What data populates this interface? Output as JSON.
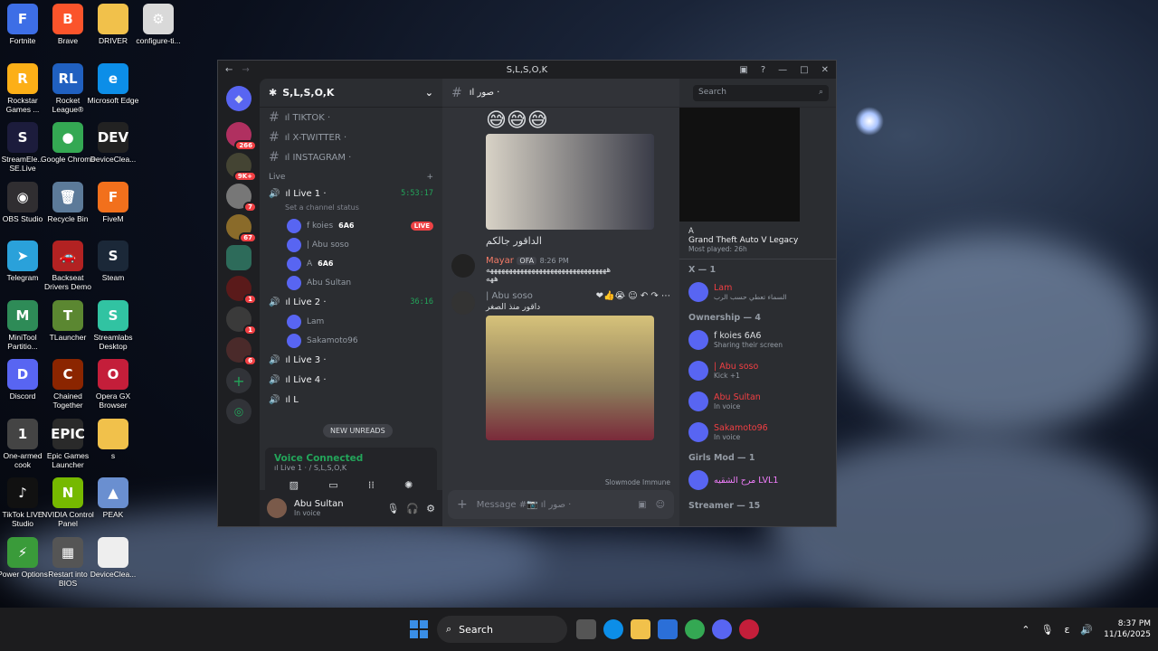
{
  "desktop": {
    "icons": [
      {
        "label": "Fortnite",
        "glyph": "F",
        "color": "#3d6ee6"
      },
      {
        "label": "Brave",
        "glyph": "B",
        "color": "#fb542b"
      },
      {
        "label": "DRIVER",
        "glyph": "",
        "color": "#f1c14b"
      },
      {
        "label": "configure-ti...",
        "glyph": "⚙",
        "color": "#d9d9d9"
      },
      {
        "label": "Rockstar Games ...",
        "glyph": "R",
        "color": "#fcaf17"
      },
      {
        "label": "Rocket League®",
        "glyph": "RL",
        "color": "#2060c0"
      },
      {
        "label": "Microsoft Edge",
        "glyph": "e",
        "color": "#0c8ee8"
      },
      {
        "label": "StreamEle... SE.Live",
        "glyph": "S",
        "color": "#1c1c3c"
      },
      {
        "label": "Google Chrome",
        "glyph": "●",
        "color": "#34a853"
      },
      {
        "label": "DeviceClea...",
        "glyph": "DEV",
        "color": "#222222"
      },
      {
        "label": "OBS Studio",
        "glyph": "◉",
        "color": "#302e31"
      },
      {
        "label": "Recycle Bin",
        "glyph": "🗑",
        "color": "#5c7a99"
      },
      {
        "label": "FiveM",
        "glyph": "F",
        "color": "#f2701c"
      },
      {
        "label": "Telegram",
        "glyph": "➤",
        "color": "#2aa1da"
      },
      {
        "label": "Backseat Drivers Demo",
        "glyph": "🚗",
        "color": "#b22222"
      },
      {
        "label": "Steam",
        "glyph": "S",
        "color": "#1b2838"
      },
      {
        "label": "MiniTool Partitio...",
        "glyph": "M",
        "color": "#2e8b57"
      },
      {
        "label": "TLauncher",
        "glyph": "T",
        "color": "#5b8731"
      },
      {
        "label": "Streamlabs Desktop",
        "glyph": "S",
        "color": "#31c3a2"
      },
      {
        "label": "Discord",
        "glyph": "D",
        "color": "#5865f2"
      },
      {
        "label": "Chained Together",
        "glyph": "C",
        "color": "#8b2500"
      },
      {
        "label": "Opera GX Browser",
        "glyph": "O",
        "color": "#c41e3a"
      },
      {
        "label": "One-armed cook",
        "glyph": "1",
        "color": "#444444"
      },
      {
        "label": "Epic Games Launcher",
        "glyph": "EPIC",
        "color": "#2a2a2a"
      },
      {
        "label": "s",
        "glyph": "",
        "color": "#f1c14b"
      },
      {
        "label": "TikTok LIVE Studio",
        "glyph": "♪",
        "color": "#111111"
      },
      {
        "label": "NVIDIA Control Panel",
        "glyph": "N",
        "color": "#76b900"
      },
      {
        "label": "PEAK",
        "glyph": "▲",
        "color": "#6a8fd0"
      },
      {
        "label": "Power Options",
        "glyph": "⚡",
        "color": "#3a9b3a"
      },
      {
        "label": "Restart into BIOS",
        "glyph": "▦",
        "color": "#555555"
      },
      {
        "label": "DeviceClea...",
        "glyph": "",
        "color": "#eeeeee"
      }
    ]
  },
  "window": {
    "title": "S,L,S,O,K",
    "server_name": "S,L,S,O,K",
    "text_channels": [
      "ıl TIKTOK ·",
      "ıl X-TWITTER ·",
      "ıl INSTAGRAM ·"
    ],
    "voice_category": "Live",
    "voice_channels": [
      {
        "name": "ıl Live 1 ·",
        "time": "5:53:17",
        "status": "Set a channel status",
        "members": [
          {
            "name": "f koies",
            "tag": "6A6",
            "live": "LIVE"
          },
          {
            "name": "| Abu soso",
            "tag": "",
            "live": ""
          },
          {
            "name": "A",
            "tag": "6A6",
            "live": ""
          },
          {
            "name": "Abu Sultan",
            "tag": "",
            "live": ""
          }
        ]
      },
      {
        "name": "ıl Live 2 ·",
        "time": "36:16",
        "status": "",
        "members": [
          {
            "name": "Lam",
            "tag": "",
            "live": ""
          },
          {
            "name": "Sakamoto96",
            "tag": "",
            "live": ""
          }
        ]
      },
      {
        "name": "ıl Live 3 ·",
        "time": "",
        "status": "",
        "members": []
      },
      {
        "name": "ıl Live 4 ·",
        "time": "",
        "status": "",
        "members": []
      },
      {
        "name": "ıl L",
        "time": "",
        "status": "",
        "members": []
      }
    ],
    "new_unreads": "NEW UNREADS",
    "voice_connected": "Voice Connected",
    "voice_location": "ıl Live 1 · / S,L,S,O,K",
    "user": {
      "name": "Abu Sultan",
      "status": "In voice"
    },
    "guild_badges": [
      "266",
      "9K+",
      "7",
      "67",
      "1",
      "1",
      "1",
      "6"
    ],
    "chat": {
      "channel": "ıl صور ·",
      "search_placeholder": "Search",
      "caption1": "الداقور جالكم",
      "msg2_author": "Mayar",
      "msg2_badge": "OFA",
      "msg2_time": "8:26 PM",
      "msg2_text": "ههههههههههههههههههههههههههههههههه",
      "msg2_text2": "ههه",
      "msg3_author": "| Abu soso",
      "msg3_text": "داقور منذ الصغر",
      "slowmode": "Slowmode Immune",
      "compose_placeholder": "Message #📷 ıl صور ·"
    },
    "members": {
      "activity_user": "A",
      "activity_game": "Grand Theft Auto V Legacy",
      "activity_played": "Most played: 26h",
      "sections": [
        {
          "title": "X — 1",
          "people": [
            {
              "name": "Lam",
              "sub": "السماء تعطي حسب الرب",
              "color": "#f23f43"
            }
          ]
        },
        {
          "title": "Ownership — 4",
          "people": [
            {
              "name": "f koies 6A6",
              "sub": "Sharing their screen",
              "color": "#dbdee1"
            },
            {
              "name": "| Abu soso",
              "sub": "Kick +1",
              "color": "#f23f43"
            },
            {
              "name": "Abu Sultan",
              "sub": "In voice",
              "color": "#f23f43"
            },
            {
              "name": "Sakamoto96",
              "sub": "In voice",
              "color": "#f23f43"
            }
          ]
        },
        {
          "title": "Girls Mod — 1",
          "people": [
            {
              "name": "مرح الشقيه LVL1",
              "sub": "",
              "color": "#f47fff"
            }
          ]
        },
        {
          "title": "Streamer — 15",
          "people": []
        }
      ]
    }
  },
  "taskbar": {
    "search": "Search",
    "time": "8:37 PM",
    "date": "11/16/2025",
    "lang": "ε"
  }
}
